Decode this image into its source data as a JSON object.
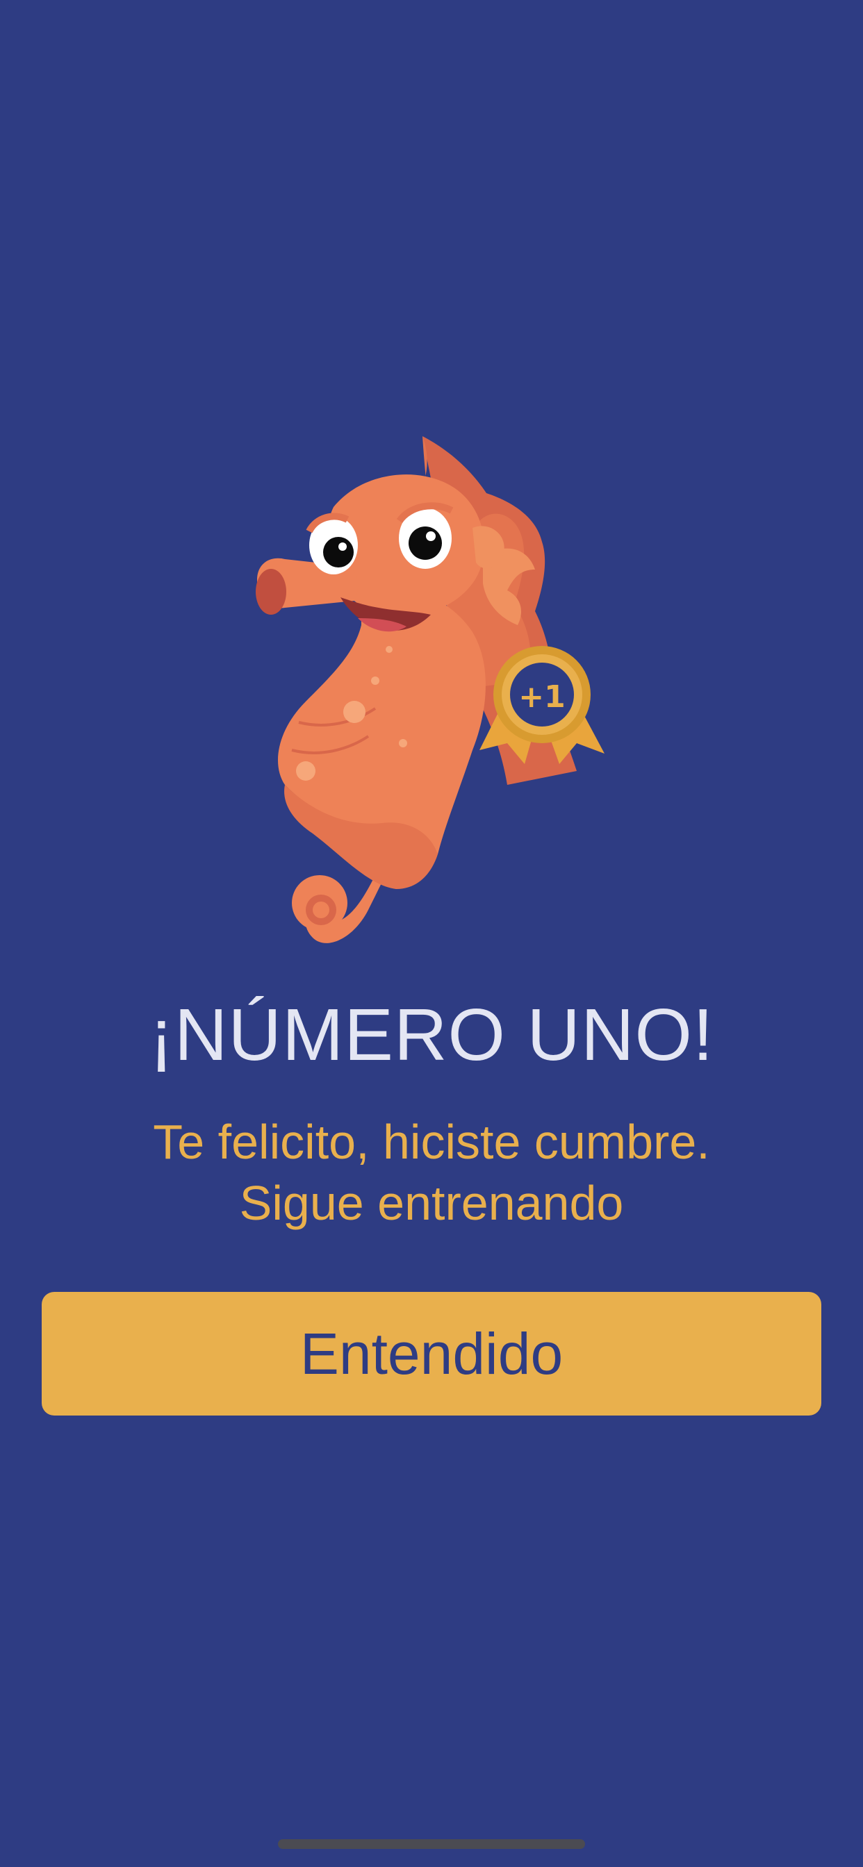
{
  "screen": {
    "background_color": "#2e3c83"
  },
  "mascot": {
    "icon": "seahorse-icon",
    "badge_icon": "award-ribbon-icon",
    "badge_text": "+1"
  },
  "title": "¡NÚMERO UNO!",
  "subtitle": {
    "line1": "Te felicito, hiciste cumbre.",
    "line2": "Sigue entrenando"
  },
  "primary_button": {
    "label": "Entendido",
    "color": "#e9b04d"
  },
  "colors": {
    "title": "#e4e6f3",
    "subtitle": "#e9b04d",
    "button_text": "#2e3c83"
  }
}
